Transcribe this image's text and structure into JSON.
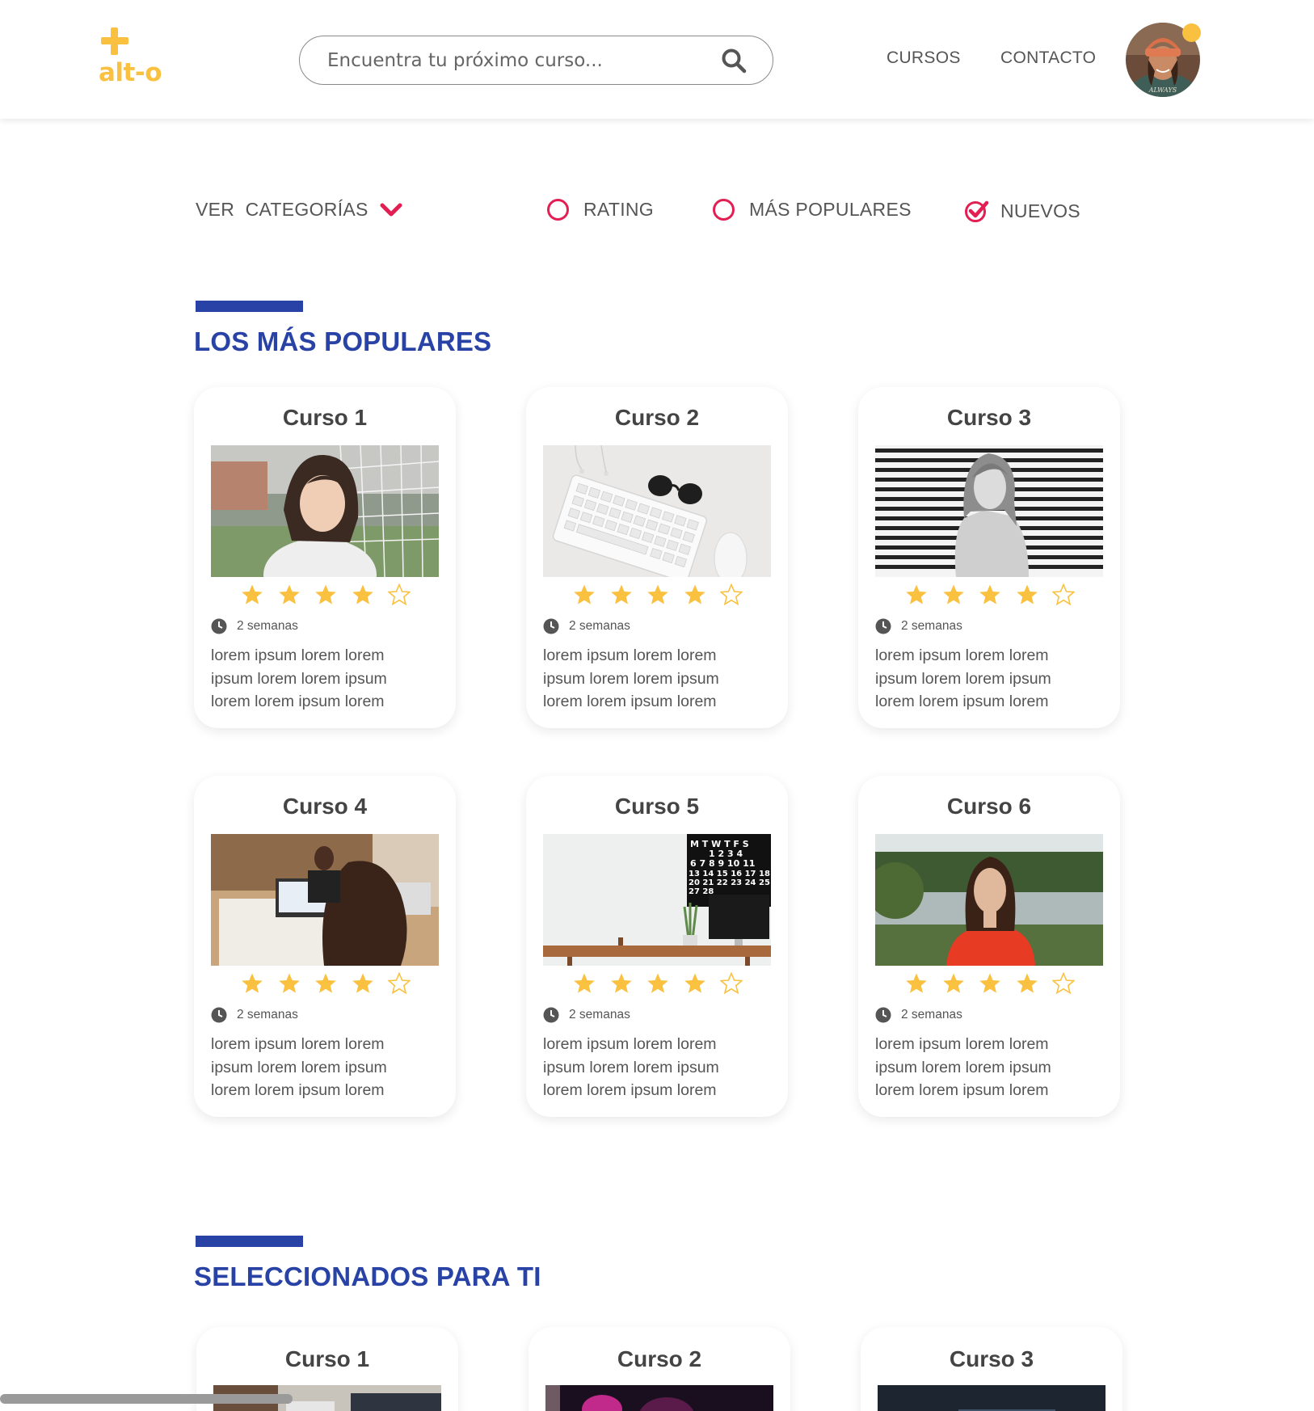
{
  "header": {
    "logo_text": "alt-o",
    "search": {
      "placeholder": "Encuentra tu próximo curso...",
      "value": ""
    },
    "nav": {
      "cursos": "CURSOS",
      "contacto": "CONTACTO"
    }
  },
  "filters": {
    "categories": "VER  CATEGORÍAS",
    "rating": "RATING",
    "populares": "MÁS POPULARES",
    "nuevos": "NUEVOS",
    "selected": "nuevos"
  },
  "sections": {
    "popular": {
      "title": "LOS MÁS POPULARES",
      "cards": [
        {
          "title": "Curso 1",
          "rating": 4,
          "duration": "2 semanas",
          "line1": "lorem ipsum lorem lorem",
          "line2": "ipsum lorem lorem ipsum",
          "line3": "lorem lorem ipsum lorem"
        },
        {
          "title": "Curso 2",
          "rating": 4,
          "duration": "2 semanas",
          "line1": "lorem ipsum lorem lorem",
          "line2": "ipsum lorem lorem ipsum",
          "line3": "lorem lorem ipsum lorem"
        },
        {
          "title": "Curso 3",
          "rating": 4,
          "duration": "2 semanas",
          "line1": "lorem ipsum lorem lorem",
          "line2": "ipsum lorem lorem ipsum",
          "line3": "lorem lorem ipsum lorem"
        },
        {
          "title": "Curso 4",
          "rating": 4,
          "duration": "2 semanas",
          "line1": "lorem ipsum lorem lorem",
          "line2": "ipsum lorem lorem ipsum",
          "line3": "lorem lorem ipsum lorem"
        },
        {
          "title": "Curso 5",
          "rating": 4,
          "duration": "2 semanas",
          "line1": "lorem ipsum lorem lorem",
          "line2": "ipsum lorem lorem ipsum",
          "line3": "lorem lorem ipsum lorem"
        },
        {
          "title": "Curso 6",
          "rating": 4,
          "duration": "2 semanas",
          "line1": "lorem ipsum lorem lorem",
          "line2": "ipsum lorem lorem ipsum",
          "line3": "lorem lorem ipsum lorem"
        }
      ]
    },
    "selected": {
      "title": "SELECCIONADOS PARA TI",
      "cards": [
        {
          "title": "Curso 1"
        },
        {
          "title": "Curso 2"
        },
        {
          "title": "Curso 3"
        }
      ]
    }
  },
  "calendar_text": {
    "row0": "M T W T F S",
    "row1": "1 2 3 4",
    "row2": "6 7 8 9 10 11",
    "row3": "13 14 15 16 17 18",
    "row4": "20 21 22 23 24 25",
    "row5": "27 28"
  },
  "colors": {
    "accent_yellow": "#f9c13f",
    "accent_blue": "#2843a5",
    "accent_red": "#e31e52"
  },
  "icons": [
    "search-icon",
    "chevron-down-icon",
    "radio-icon",
    "check-circle-icon",
    "star-icon",
    "clock-icon"
  ]
}
